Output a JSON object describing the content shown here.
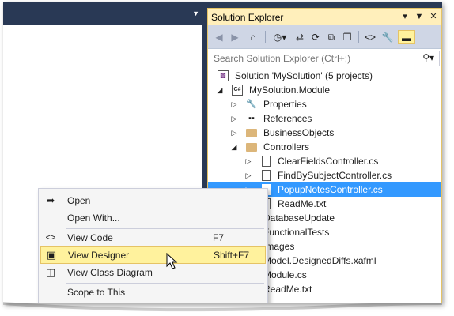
{
  "solution_explorer": {
    "title": "Solution Explorer",
    "title_icons": [
      "chevron-down-icon",
      "pin-icon",
      "close-icon"
    ],
    "search_placeholder": "Search Solution Explorer (Ctrl+;)",
    "tree": [
      {
        "label": "Solution 'MySolution' (5 projects)",
        "icon": "solution-icon",
        "expanded": null
      },
      {
        "label": "MySolution.Module",
        "icon": "csharp-project-icon",
        "expanded": true
      },
      {
        "label": "Properties",
        "icon": "wrench-icon",
        "expanded": false
      },
      {
        "label": "References",
        "icon": "references-icon",
        "expanded": false
      },
      {
        "label": "BusinessObjects",
        "icon": "folder-icon",
        "expanded": false
      },
      {
        "label": "Controllers",
        "icon": "folder-icon",
        "expanded": true
      },
      {
        "label": "ClearFieldsController.cs",
        "icon": "file-icon",
        "expanded": false
      },
      {
        "label": "FindBySubjectController.cs",
        "icon": "file-icon",
        "expanded": false
      },
      {
        "label": "PopupNotesController.cs",
        "icon": "file-icon",
        "expanded": false,
        "selected": true
      },
      {
        "label": "ReadMe.txt",
        "icon": "file-icon",
        "expanded": null
      },
      {
        "label": "DatabaseUpdate",
        "icon": "folder-icon",
        "expanded": false
      },
      {
        "label": "FunctionalTests",
        "icon": "folder-icon",
        "expanded": false
      },
      {
        "label": "Images",
        "icon": "folder-icon",
        "expanded": false
      },
      {
        "label": "Model.DesignedDiffs.xafml",
        "icon": "file-icon",
        "expanded": null
      },
      {
        "label": "Module.cs",
        "icon": "file-icon",
        "expanded": null
      },
      {
        "label": "ReadMe.txt",
        "icon": "file-icon",
        "expanded": null
      }
    ]
  },
  "context_menu": {
    "items": [
      {
        "label": "Open",
        "shortcut": "",
        "icon": "open-arrow-icon"
      },
      {
        "label": "Open With...",
        "shortcut": "",
        "icon": ""
      },
      {
        "label": "View Code",
        "shortcut": "F7",
        "icon": "code-icon"
      },
      {
        "label": "View Designer",
        "shortcut": "Shift+F7",
        "icon": "designer-icon",
        "highlighted": true
      },
      {
        "label": "View Class Diagram",
        "shortcut": "",
        "icon": "class-diagram-icon"
      },
      {
        "label": "Scope to This",
        "shortcut": "",
        "icon": ""
      }
    ]
  },
  "colors": {
    "ide_background": "#293955",
    "title_bar_active": "#ffefbb",
    "selection": "#3399ff",
    "menu_highlight": "#fff29d"
  }
}
